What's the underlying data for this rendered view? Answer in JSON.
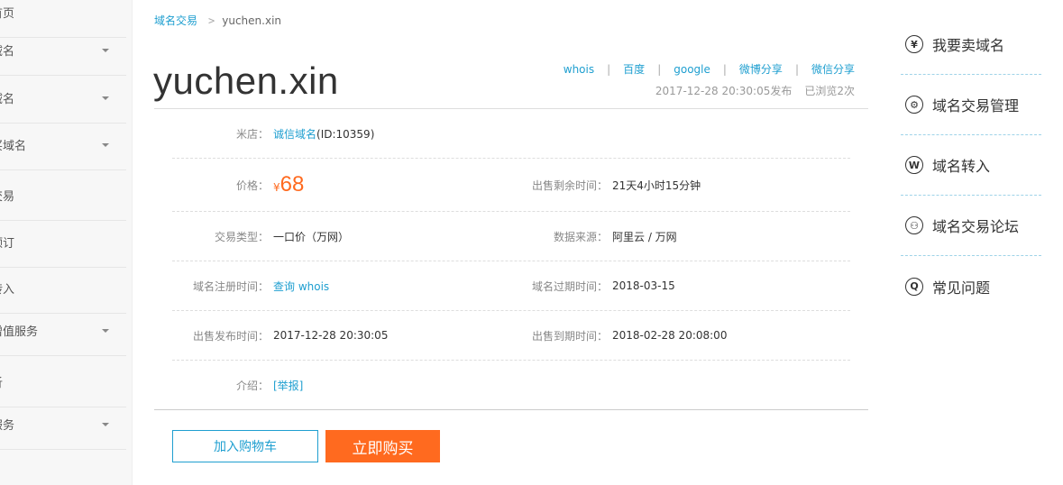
{
  "sidebar": {
    "items": [
      {
        "label": "首页",
        "caret": false
      },
      {
        "label": "域名",
        "caret": true
      },
      {
        "label": "域名",
        "caret": true
      },
      {
        "label": "买域名",
        "caret": true
      },
      {
        "label": "交易",
        "caret": false
      },
      {
        "label": "预订",
        "caret": false
      },
      {
        "label": "转入",
        "caret": false
      },
      {
        "label": "增值服务",
        "caret": true
      },
      {
        "label": "析",
        "caret": false
      },
      {
        "label": "服务",
        "caret": true
      }
    ]
  },
  "breadcrumb": {
    "parent": "域名交易",
    "separator": ">",
    "current": "yuchen.xin"
  },
  "domain": {
    "name": "yuchen.xin"
  },
  "share": {
    "whois": "whois",
    "baidu": "百度",
    "google": "google",
    "weibo": "微博分享",
    "wechat": "微信分享",
    "separator": "|"
  },
  "meta": {
    "published": "2017-12-28 20:30:05发布",
    "views": "已浏览2次"
  },
  "details": {
    "shop_label": "米店：",
    "shop_name": "诚信域名",
    "shop_id": "(ID:10359)",
    "price_label": "价格：",
    "price_symbol": "¥",
    "price_value": "68",
    "remaining_label": "出售剩余时间：",
    "remaining_value": "21天4小时15分钟",
    "type_label": "交易类型：",
    "type_value": "一口价（万网）",
    "source_label": "数据来源：",
    "source_value": "阿里云 / 万网",
    "reg_label": "域名注册时间：",
    "reg_value": "查询 whois",
    "expire_label": "域名过期时间：",
    "expire_value": "2018-03-15",
    "pub_label": "出售发布时间：",
    "pub_value": "2017-12-28 20:30:05",
    "end_label": "出售到期时间：",
    "end_value": "2018-02-28 20:08:00",
    "intro_label": "介绍：",
    "intro_value": "[举报]"
  },
  "actions": {
    "cart": "加入购物车",
    "buy": "立即购买"
  },
  "right_menu": {
    "items": [
      {
        "icon": "yen-icon",
        "glyph": "¥",
        "label": "我要卖域名"
      },
      {
        "icon": "gear-icon",
        "glyph": "⚙",
        "label": "域名交易管理"
      },
      {
        "icon": "w-icon",
        "glyph": "W",
        "label": "域名转入"
      },
      {
        "icon": "user-icon",
        "glyph": "⚇",
        "label": "域名交易论坛"
      },
      {
        "icon": "q-icon",
        "glyph": "Q",
        "label": "常见问题"
      }
    ]
  },
  "colors": {
    "accent_blue": "#1f9fd0",
    "accent_orange": "#ff6a1f"
  }
}
